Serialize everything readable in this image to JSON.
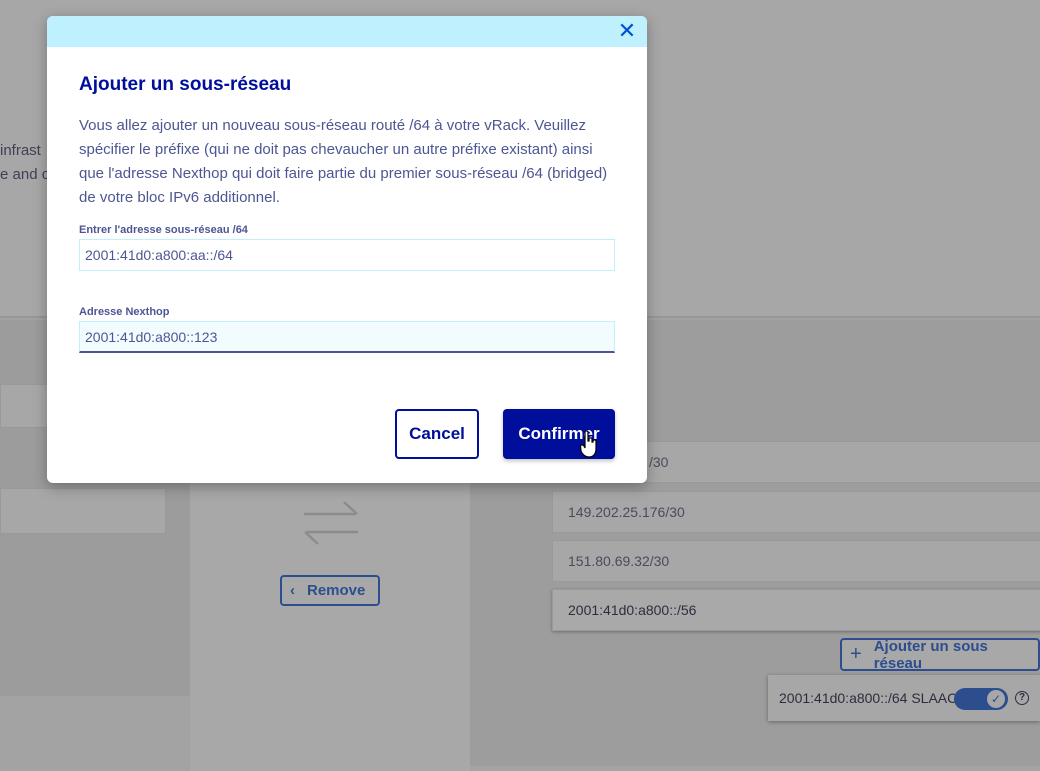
{
  "background": {
    "text_line_1": "infrast",
    "text_line_2": "e and c",
    "subnets": [
      "/30",
      "149.202.25.176/30",
      "151.80.69.32/30",
      "2001:41d0:a800::/56"
    ],
    "remove_label": "Remove",
    "add_subnet_label": "Ajouter un sous réseau",
    "slaac_text": "2001:41d0:a800::/64 SLAAC",
    "help_glyph": "?",
    "toggle_checked": true
  },
  "modal": {
    "title": "Ajouter un sous-réseau",
    "description": "Vous allez ajouter un nouveau sous-réseau routé /64 à votre vRack. Veuillez spécifier le préfixe (qui ne doit pas chevaucher un autre préfixe existant) ainsi que l'adresse Nexthop qui doit faire partie du premier sous-réseau /64 (bridged) de votre bloc IPv6 additionnel.",
    "subnet_label": "Entrer l'adresse sous-réseau /64",
    "subnet_value": "2001:41d0:a800:aa::/64",
    "nexthop_label": "Adresse Nexthop",
    "nexthop_value": "2001:41d0:a800::123",
    "cancel_label": "Cancel",
    "confirm_label": "Confirmer",
    "close_glyph": "✕"
  },
  "colors": {
    "accent": "#000e9c",
    "header_bg": "#bef1fd",
    "text": "#4d5693"
  }
}
